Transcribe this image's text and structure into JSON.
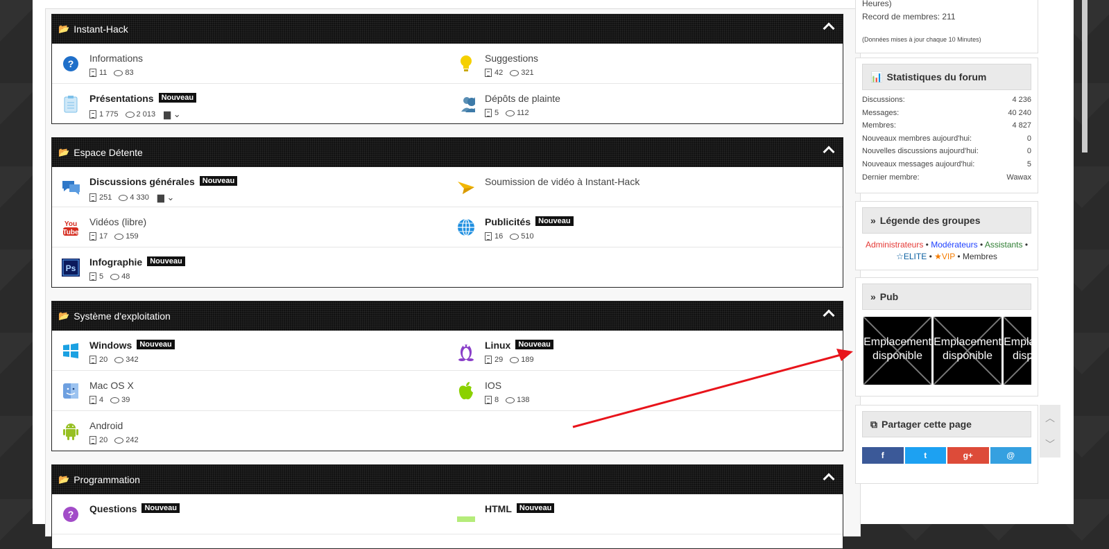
{
  "categories": [
    {
      "title": "Instant-Hack",
      "forums": [
        {
          "name": "Informations",
          "bold": false,
          "badge": "",
          "topics": "11",
          "posts": "83",
          "icon": "question-icon",
          "subforums": false
        },
        {
          "name": "Suggestions",
          "bold": false,
          "badge": "",
          "topics": "42",
          "posts": "321",
          "icon": "lightbulb-icon",
          "subforums": false
        },
        {
          "name": "Présentations",
          "bold": true,
          "badge": "Nouveau",
          "topics": "1 775",
          "posts": "2 013",
          "icon": "clipboard-icon",
          "subforums": true
        },
        {
          "name": "Dépôts de plainte",
          "bold": false,
          "badge": "",
          "topics": "5",
          "posts": "112",
          "icon": "users-icon",
          "subforums": false
        }
      ]
    },
    {
      "title": "Espace Détente",
      "forums": [
        {
          "name": "Discussions générales",
          "bold": true,
          "badge": "Nouveau",
          "topics": "251",
          "posts": "4 330",
          "icon": "chat-icon",
          "subforums": true
        },
        {
          "name": "Soumission de vidéo à Instant-Hack",
          "bold": false,
          "badge": "",
          "topics": "",
          "posts": "",
          "icon": "paper-plane-icon",
          "subforums": false
        },
        {
          "name": "Vidéos (libre)",
          "bold": false,
          "badge": "",
          "topics": "17",
          "posts": "159",
          "icon": "youtube-icon",
          "subforums": false
        },
        {
          "name": "Publicités",
          "bold": true,
          "badge": "Nouveau",
          "topics": "16",
          "posts": "510",
          "icon": "globe-icon",
          "subforums": false
        },
        {
          "name": "Infographie",
          "bold": true,
          "badge": "Nouveau",
          "topics": "5",
          "posts": "48",
          "icon": "photoshop-icon",
          "subforums": false
        }
      ]
    },
    {
      "title": "Système d'exploitation",
      "forums": [
        {
          "name": "Windows",
          "bold": true,
          "badge": "Nouveau",
          "topics": "20",
          "posts": "342",
          "icon": "windows-icon",
          "subforums": false
        },
        {
          "name": "Linux",
          "bold": true,
          "badge": "Nouveau",
          "topics": "29",
          "posts": "189",
          "icon": "linux-icon",
          "subforums": false
        },
        {
          "name": "Mac OS X",
          "bold": false,
          "badge": "",
          "topics": "4",
          "posts": "39",
          "icon": "finder-icon",
          "subforums": false
        },
        {
          "name": "IOS",
          "bold": false,
          "badge": "",
          "topics": "8",
          "posts": "138",
          "icon": "apple-icon",
          "subforums": false
        },
        {
          "name": "Android",
          "bold": false,
          "badge": "",
          "topics": "20",
          "posts": "242",
          "icon": "android-icon",
          "subforums": false
        }
      ]
    },
    {
      "title": "Programmation",
      "forums": [
        {
          "name": "Questions",
          "bold": true,
          "badge": "Nouveau",
          "icon": "question-purple-icon"
        },
        {
          "name": "HTML",
          "bold": true,
          "badge": "Nouveau",
          "icon": "html-icon"
        }
      ]
    }
  ],
  "online": {
    "line1": "Heures)",
    "record": "Record de membres: 211",
    "note": "(Données mises à jour chaque 10 Minutes)"
  },
  "stats": {
    "title": "Statistiques du forum",
    "rows": [
      {
        "label": "Discussions:",
        "value": "4 236"
      },
      {
        "label": "Messages:",
        "value": "40 240"
      },
      {
        "label": "Membres:",
        "value": "4 827"
      },
      {
        "label": "Nouveaux membres aujourd'hui:",
        "value": "0"
      },
      {
        "label": "Nouvelles discussions aujourd'hui:",
        "value": "0"
      },
      {
        "label": "Nouveaux messages aujourd'hui:",
        "value": "5"
      },
      {
        "label": "Dernier membre:",
        "value": "Wawax"
      }
    ]
  },
  "legend": {
    "title": "Légende des groupes",
    "admins": "Administrateurs",
    "mods": "Modérateurs",
    "assistants": "Assistants",
    "elite": "ELITE",
    "vip": "VIP",
    "members": "Membres",
    "sep": "•",
    "colors": {
      "admins": "#e53935",
      "mods": "#1e40ff",
      "assistants": "#2e7d32",
      "elite": "#0a5fa0",
      "vip": "#f57c00"
    }
  },
  "pub": {
    "title": "Pub",
    "slots": [
      "Emplacement disponible",
      "Emplacement disponible",
      "Emplacement disponible"
    ]
  },
  "share": {
    "title": "Partager cette page",
    "buttons": [
      {
        "icon": "f",
        "name": "facebook-share-icon",
        "color": "#3b5998"
      },
      {
        "icon": "t",
        "name": "twitter-share-icon",
        "color": "#1da1f2"
      },
      {
        "icon": "g+",
        "name": "googleplus-share-icon",
        "color": "#dd4b39"
      },
      {
        "icon": "@",
        "name": "email-share-icon",
        "color": "#35a0e0"
      }
    ]
  }
}
